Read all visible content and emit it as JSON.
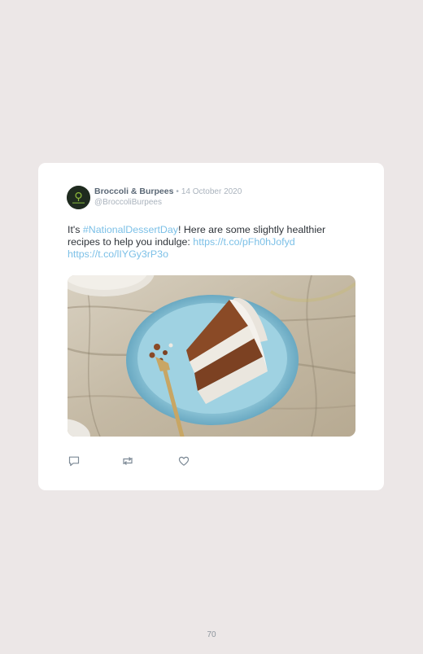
{
  "tweet": {
    "author_name": "Broccoli & Burpees",
    "separator": "•",
    "date": "14 October 2020",
    "handle": "@BroccoliBurpees",
    "text_intro": "It's ",
    "hashtag": "#NationalDessertDay",
    "text_body": "! Here are some slightly healthier recipes to help you indulge: ",
    "link_1": "https://t.co/pFh0hJofyd",
    "link_2": "https://t.co/lIYGy3rP3o",
    "image_icon": "carrot-cake-slice-photo",
    "actions": [
      {
        "name": "reply",
        "icon": "speech-bubble-icon"
      },
      {
        "name": "retweet",
        "icon": "retweet-arrows-icon"
      },
      {
        "name": "like",
        "icon": "heart-icon"
      }
    ]
  },
  "page_number": "70",
  "colors": {
    "background": "#ece7e7",
    "card": "#ffffff",
    "author_name": "#5b6876",
    "meta_text": "#aab3bd",
    "link": "#7cc0e7",
    "body_text": "#2f343a",
    "icon": "#7d8a96"
  }
}
